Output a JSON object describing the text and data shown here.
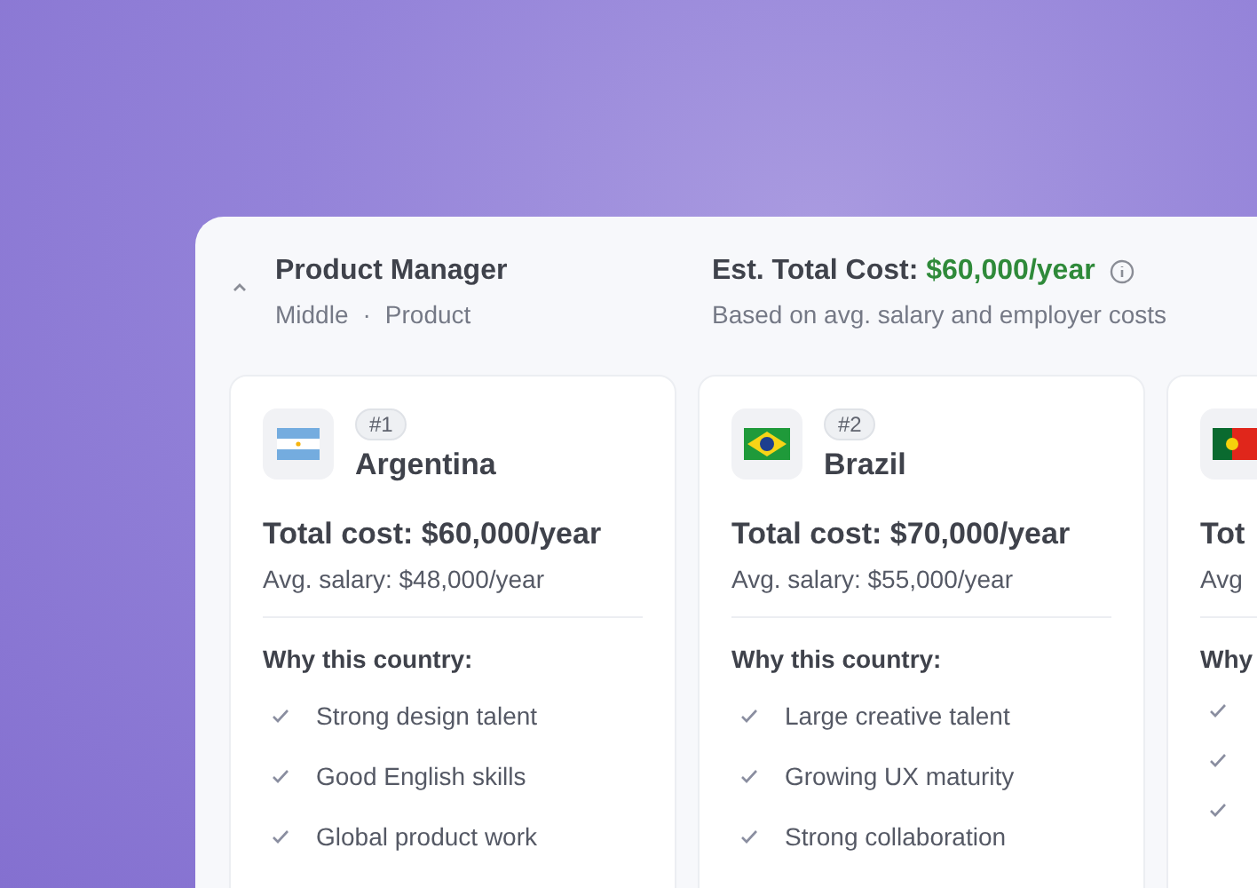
{
  "role": {
    "title": "Product Manager",
    "level": "Middle",
    "separator": "·",
    "department": "Product",
    "expanded": true
  },
  "estimate": {
    "label": "Est. Total Cost:",
    "value": "$60,000/year",
    "note": "Based on avg. salary and employer costs"
  },
  "countries": [
    {
      "kind": "argentina",
      "rank": "#1",
      "name": "Argentina",
      "total": "Total cost: $60,000/year",
      "salary": "Avg. salary: $48,000/year",
      "why": "Why this country:",
      "reasons": [
        {
          "kind": "check",
          "text": "Strong design talent"
        },
        {
          "kind": "check",
          "text": "Good English skills"
        },
        {
          "kind": "check",
          "text": "Global product work"
        }
      ]
    },
    {
      "kind": "brazil",
      "rank": "#2",
      "name": "Brazil",
      "total": "Total cost: $70,000/year",
      "salary": "Avg. salary: $55,000/year",
      "why": "Why this country:",
      "reasons": [
        {
          "kind": "check",
          "text": "Large creative talent"
        },
        {
          "kind": "check",
          "text": "Growing UX maturity"
        },
        {
          "kind": "check",
          "text": "Strong collaboration"
        }
      ]
    },
    {
      "kind": "portugal",
      "total": "Tot",
      "salary": "Avg",
      "why": "Why",
      "reasons": [
        {
          "kind": "check"
        },
        {
          "kind": "check"
        },
        {
          "kind": "check"
        }
      ]
    }
  ]
}
